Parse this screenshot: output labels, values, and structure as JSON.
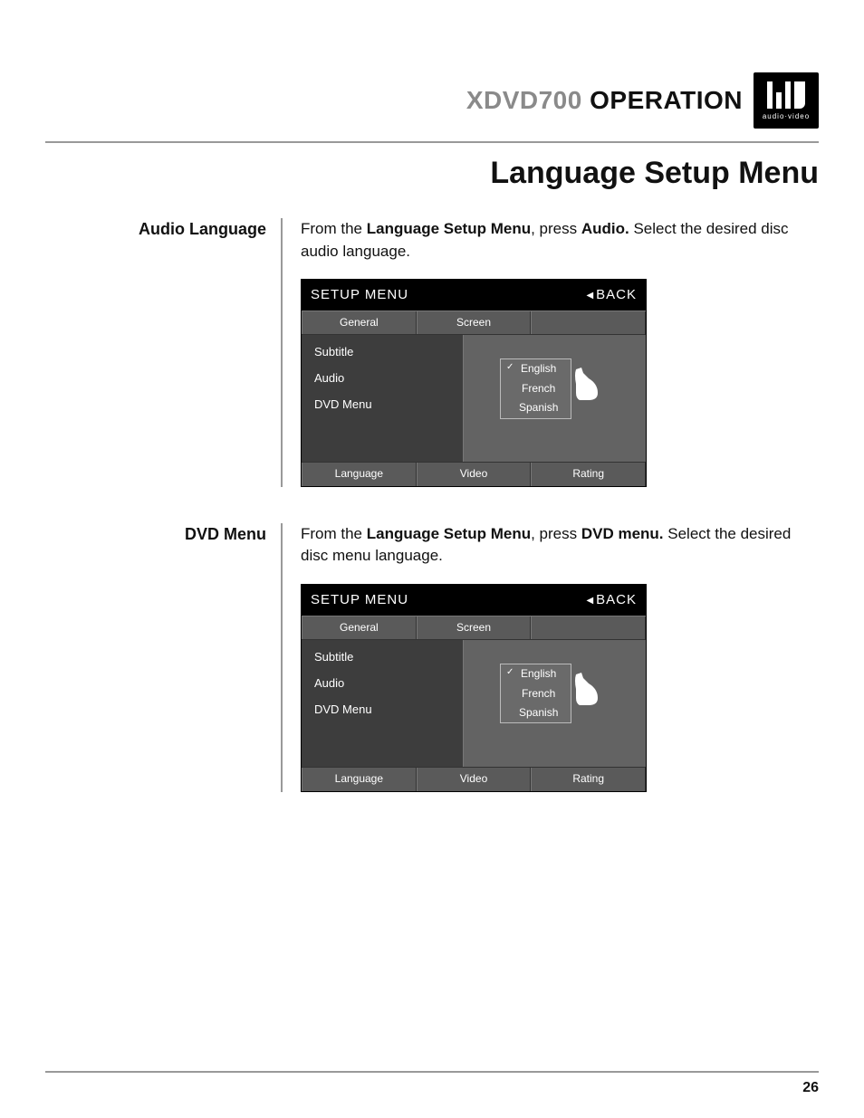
{
  "header": {
    "model": "XDVD700",
    "word": "OPERATION",
    "logo_sub": "audio·video"
  },
  "page_title": "Language Setup Menu",
  "page_number": "26",
  "sections": [
    {
      "label": "Audio Language",
      "desc_prefix": "From the ",
      "desc_b1": "Language Setup Menu",
      "desc_mid": ", press ",
      "desc_b2": "Audio.",
      "desc_suffix": " Select the desired disc audio language."
    },
    {
      "label": "DVD Menu",
      "desc_prefix": "From the ",
      "desc_b1": "Language Setup Menu",
      "desc_mid": ", press ",
      "desc_b2": "DVD menu.",
      "desc_suffix": " Select the desired disc menu language."
    }
  ],
  "setup": {
    "title": "SETUP MENU",
    "back": "BACK",
    "tabs_top": [
      "General",
      "Screen",
      ""
    ],
    "left_items": [
      "Subtitle",
      "Audio",
      "DVD Menu"
    ],
    "options": [
      "English",
      "French",
      "Spanish"
    ],
    "tabs_bottom": [
      "Language",
      "Video",
      "Rating"
    ]
  }
}
